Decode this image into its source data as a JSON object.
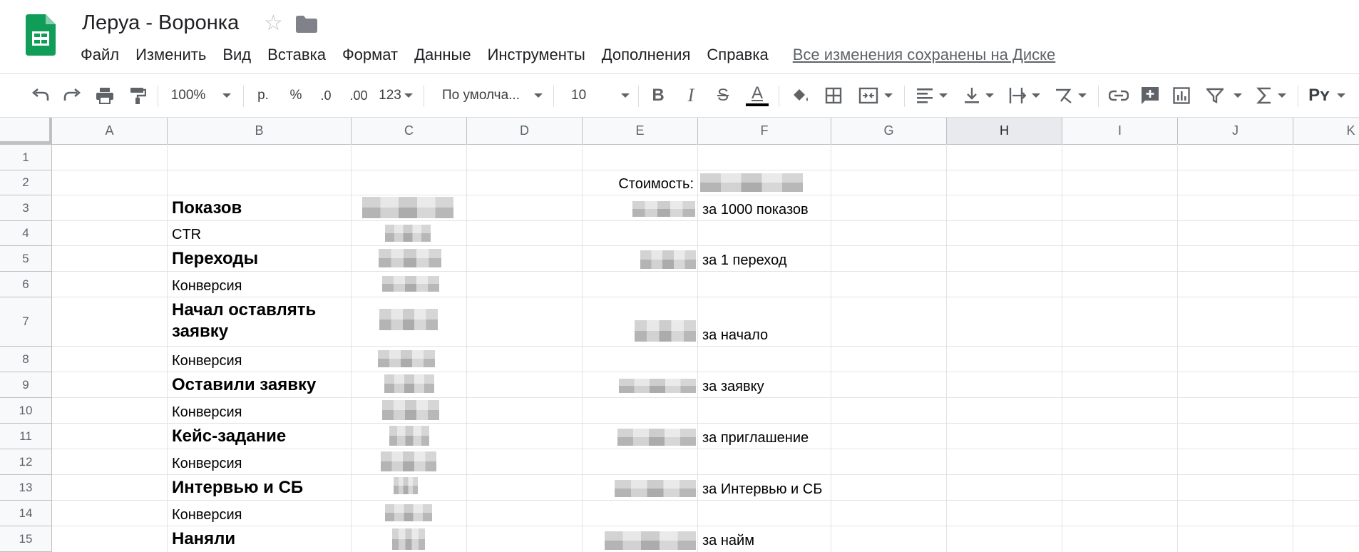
{
  "doc": {
    "title": "Леруа - Воронка"
  },
  "menu": [
    "Файл",
    "Изменить",
    "Вид",
    "Вставка",
    "Формат",
    "Данные",
    "Инструменты",
    "Дополнения",
    "Справка"
  ],
  "saved_status": "Все изменения сохранены на Диске",
  "toolbar": {
    "zoom": "100%",
    "currency": "р.",
    "percent": "%",
    "decrease_decimals": ".0",
    "increase_decimals": ".00",
    "more_formats": "123",
    "font": "По умолча...",
    "font_size": "10",
    "bold": "B",
    "italic": "I",
    "strike": "S",
    "text_color": "A",
    "input_tools": "Pʏ"
  },
  "columns": [
    "A",
    "B",
    "C",
    "D",
    "E",
    "F",
    "G",
    "H",
    "I",
    "J",
    "K"
  ],
  "selected_column": "H",
  "rows": [
    "1",
    "2",
    "3",
    "4",
    "5",
    "6",
    "7",
    "8",
    "9",
    "10",
    "11",
    "12",
    "13",
    "14",
    "15"
  ],
  "cells": {
    "E2": "Стоимость:",
    "B3": "Показов",
    "F3": "за 1000 показов",
    "B4": "CTR",
    "B5": "Переходы",
    "F5": "за 1 переход",
    "B6": "Конверсия",
    "B7": "Начал оставлять заявку",
    "F7": "за начало",
    "B8": "Конверсия",
    "B9": "Оставили заявку",
    "F9": "за заявку",
    "B10": "Конверсия",
    "B11": "Кейс-задание",
    "F11": "за приглашение",
    "B12": "Конверсия",
    "B13": "Интервью и СБ",
    "F13": "за Интервью и СБ",
    "B14": "Конверсия",
    "B15": "Наняли",
    "F15": "за найм"
  },
  "colors": {
    "sheets_green": "#0f9d58",
    "selected_header": "#e8eaed",
    "grid_line": "#e2e3e3"
  },
  "icons": [
    "sheets-logo-icon",
    "star-icon",
    "folder-icon",
    "undo-icon",
    "redo-icon",
    "print-icon",
    "paint-format-icon",
    "fill-color-icon",
    "borders-icon",
    "merge-cells-icon",
    "align-left-icon",
    "vertical-align-icon",
    "text-wrap-icon",
    "text-rotate-icon",
    "link-icon",
    "comment-icon",
    "chart-icon",
    "filter-icon",
    "functions-icon"
  ]
}
